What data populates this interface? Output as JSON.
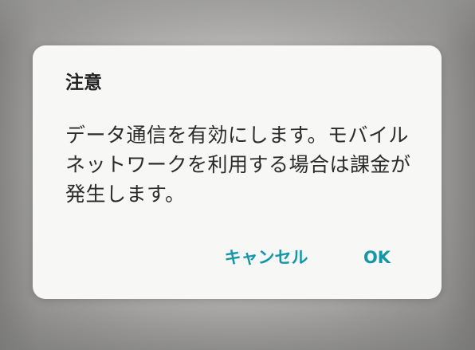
{
  "dialog": {
    "title": "注意",
    "message": "データ通信を有効にします。モバイルネットワークを利用する場合は課金が発生します。",
    "cancel_label": "キャンセル",
    "ok_label": "OK",
    "accent_color": "#1697a8"
  }
}
